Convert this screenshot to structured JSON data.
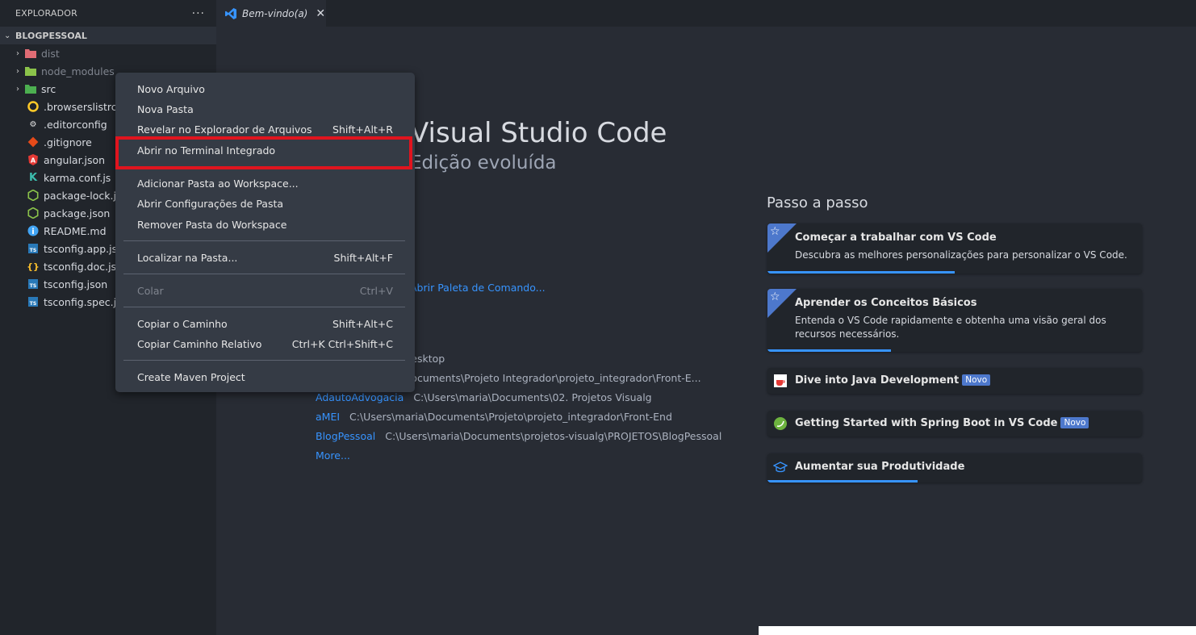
{
  "sidebar": {
    "title": "EXPLORADOR",
    "more": "···",
    "project": "BLOGPESSOAL",
    "items": [
      {
        "label": "dist",
        "type": "folder",
        "icon": "folder-dist-icon"
      },
      {
        "label": "node_modules",
        "type": "folder",
        "icon": "folder-node-icon"
      },
      {
        "label": "src",
        "type": "folder",
        "icon": "folder-src-icon"
      },
      {
        "label": ".browserslistrc",
        "type": "file",
        "icon": "browserslist-icon"
      },
      {
        "label": ".editorconfig",
        "type": "file",
        "icon": "editorconfig-icon"
      },
      {
        "label": ".gitignore",
        "type": "file",
        "icon": "git-icon"
      },
      {
        "label": "angular.json",
        "type": "file",
        "icon": "angular-icon"
      },
      {
        "label": "karma.conf.js",
        "type": "file",
        "icon": "karma-icon"
      },
      {
        "label": "package-lock.json",
        "type": "file",
        "icon": "nodejs-icon"
      },
      {
        "label": "package.json",
        "type": "file",
        "icon": "nodejs-icon"
      },
      {
        "label": "README.md",
        "type": "file",
        "icon": "info-icon"
      },
      {
        "label": "tsconfig.app.json",
        "type": "file",
        "icon": "tsconfig-icon"
      },
      {
        "label": "tsconfig.doc.json",
        "type": "file",
        "icon": "json-icon"
      },
      {
        "label": "tsconfig.json",
        "type": "file",
        "icon": "tsconfig-icon"
      },
      {
        "label": "tsconfig.spec.json",
        "type": "file",
        "icon": "tsconfig-icon"
      }
    ]
  },
  "tab": {
    "label": "Bem-vindo(a)",
    "close": "✕"
  },
  "welcome": {
    "title": "Visual Studio Code",
    "subtitle": "Edição evoluída",
    "command_link": "Abrir Paleta de Comando...",
    "recent": [
      {
        "name": "",
        "path": "C:\\Users\\maria\\Desktop"
      },
      {
        "name": "",
        "path": "C:\\Users\\maria\\Documents\\Projeto Integrador\\projeto_integrador\\Front-E..."
      },
      {
        "name": "AdautoAdvogacia",
        "path": "C:\\Users\\maria\\Documents\\02. Projetos Visualg"
      },
      {
        "name": "aMEI",
        "path": "C:\\Users\\maria\\Documents\\Projeto\\projeto_integrador\\Front-End"
      },
      {
        "name": "BlogPessoal",
        "path": "C:\\Users\\maria\\Documents\\projetos-visualg\\PROJETOS\\BlogPessoal"
      }
    ],
    "more": "More..."
  },
  "walkthroughs": {
    "title": "Passo a passo",
    "cards": [
      {
        "title": "Começar a trabalhar com VS Code",
        "desc": "Descubra as melhores personalizações para personalizar o VS Code.",
        "progress": 0.5
      },
      {
        "title": "Aprender os Conceitos Básicos",
        "desc": "Entenda o VS Code rapidamente e obtenha uma visão geral dos recursos necessários.",
        "progress": 0.33
      },
      {
        "title": "Dive into Java Development",
        "badge": "Novo",
        "icon": "java-icon"
      },
      {
        "title": "Getting Started with Spring Boot in VS Code",
        "badge": "Novo",
        "icon": "spring-icon"
      },
      {
        "title": "Aumentar sua Produtividade",
        "icon": "mortarboard-icon",
        "progress": 0.4
      }
    ]
  },
  "context_menu": {
    "items": [
      {
        "label": "Novo Arquivo",
        "kb": ""
      },
      {
        "label": "Nova Pasta",
        "kb": ""
      },
      {
        "label": "Revelar no Explorador de Arquivos",
        "kb": "Shift+Alt+R"
      },
      {
        "label": "Abrir no Terminal Integrado",
        "kb": ""
      },
      {
        "label": "Adicionar Pasta ao Workspace...",
        "kb": ""
      },
      {
        "label": "Abrir Configurações de Pasta",
        "kb": ""
      },
      {
        "label": "Remover Pasta do Workspace",
        "kb": ""
      },
      {
        "label": "Localizar na Pasta...",
        "kb": "Shift+Alt+F"
      },
      {
        "label": "Colar",
        "kb": "Ctrl+V",
        "disabled": true
      },
      {
        "label": "Copiar o Caminho",
        "kb": "Shift+Alt+C"
      },
      {
        "label": "Copiar Caminho Relativo",
        "kb": "Ctrl+K Ctrl+Shift+C"
      },
      {
        "label": "Create Maven Project",
        "kb": ""
      }
    ]
  },
  "colors": {
    "accent": "#3794ff",
    "highlight": "#e0141e",
    "badge": "#4d78cc"
  }
}
